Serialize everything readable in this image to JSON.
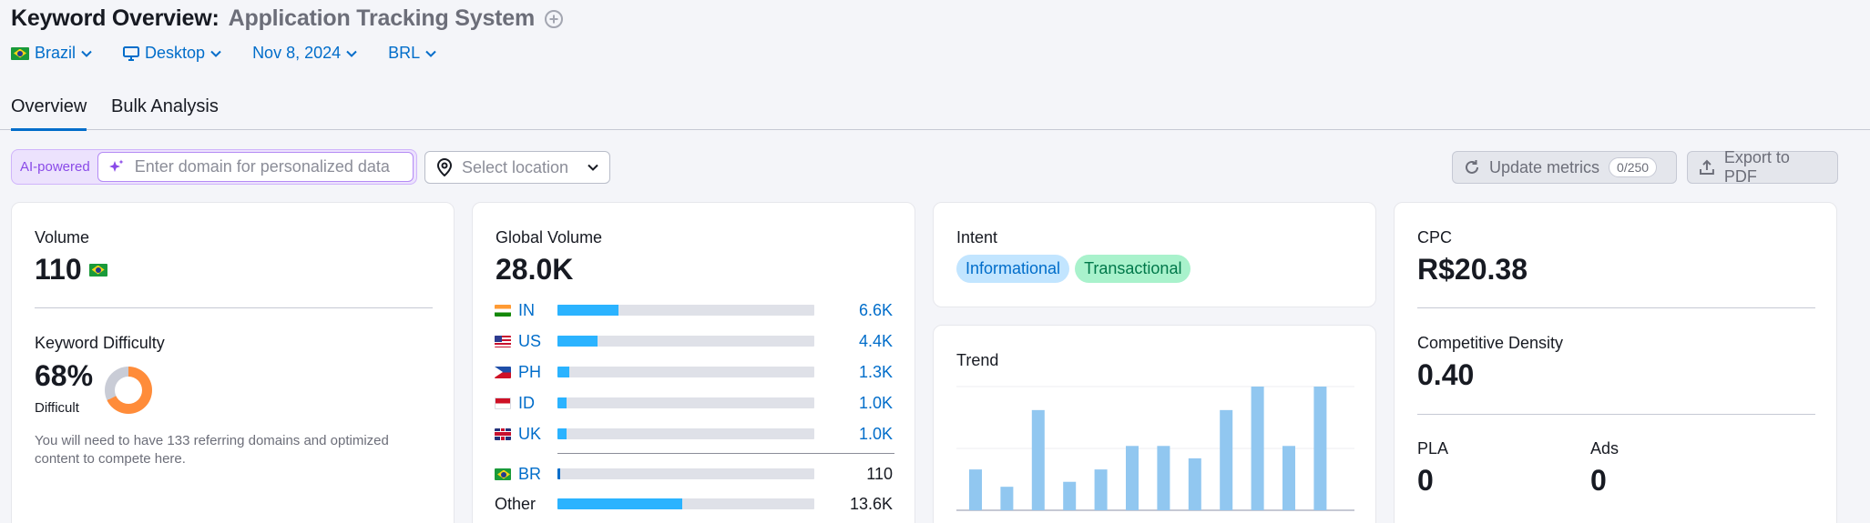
{
  "header": {
    "title_prefix": "Keyword Overview:",
    "keyword": "Application Tracking System"
  },
  "filters": {
    "country": "Brazil",
    "device": "Desktop",
    "date": "Nov 8, 2024",
    "currency": "BRL"
  },
  "tabs": [
    {
      "label": "Overview",
      "active": true
    },
    {
      "label": "Bulk Analysis",
      "active": false
    }
  ],
  "toolbar": {
    "ai_label": "AI-powered",
    "domain_placeholder": "Enter domain for personalized data",
    "location_placeholder": "Select location",
    "update_label": "Update metrics",
    "update_count": "0/250",
    "export_label": "Export to PDF"
  },
  "volume_card": {
    "volume_label": "Volume",
    "volume_value": "110",
    "kd_label": "Keyword Difficulty",
    "kd_value": "68%",
    "kd_percent": 68,
    "kd_level": "Difficult",
    "kd_note": "You will need to have 133 referring domains and optimized content to compete here."
  },
  "global_volume": {
    "label": "Global Volume",
    "value": "28.0K",
    "rows": [
      {
        "code": "IN",
        "value": "6.6K",
        "fraction": 0.236
      },
      {
        "code": "US",
        "value": "4.4K",
        "fraction": 0.157
      },
      {
        "code": "PH",
        "value": "1.3K",
        "fraction": 0.046
      },
      {
        "code": "ID",
        "value": "1.0K",
        "fraction": 0.036
      },
      {
        "code": "UK",
        "value": "1.0K",
        "fraction": 0.036
      }
    ],
    "local": {
      "code": "BR",
      "value": "110",
      "fraction": 0.004
    },
    "other": {
      "label": "Other",
      "value": "13.6K",
      "fraction": 0.486
    }
  },
  "intent": {
    "label": "Intent",
    "tags": [
      "Informational",
      "Transactional"
    ]
  },
  "trend": {
    "label": "Trend",
    "values": [
      0.33,
      0.19,
      0.81,
      0.23,
      0.33,
      0.52,
      0.52,
      0.42,
      0.81,
      1.0,
      0.52,
      1.0
    ]
  },
  "cpc_card": {
    "cpc_label": "CPC",
    "cpc_value": "R$20.38",
    "cd_label": "Competitive Density",
    "cd_value": "0.40",
    "pla_label": "PLA",
    "pla_value": "0",
    "ads_label": "Ads",
    "ads_value": "0"
  },
  "colors": {
    "link": "#006dca",
    "bar": "#2bb3ff",
    "trend_bar": "#91c7f0",
    "difficulty": "#ff8c3a",
    "ai_purple": "#8a4ae8"
  }
}
